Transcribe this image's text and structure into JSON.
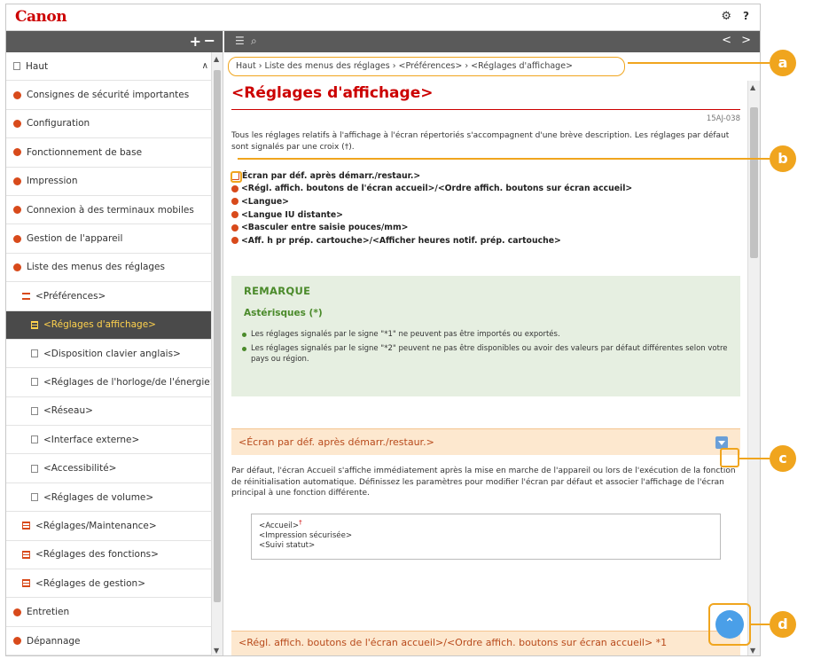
{
  "app": {
    "logo": "Canon",
    "settings_icon": "gear-icon",
    "help_label": "?"
  },
  "sidebar": {
    "plus": "+",
    "minus": "−",
    "items": [
      {
        "label": "Haut",
        "icon": "square"
      },
      {
        "label": "Consignes de sécurité importantes",
        "icon": "dot"
      },
      {
        "label": "Configuration",
        "icon": "dot"
      },
      {
        "label": "Fonctionnement de base",
        "icon": "dot"
      },
      {
        "label": "Impression",
        "icon": "dot"
      },
      {
        "label": "Connexion à des terminaux mobiles",
        "icon": "dot"
      },
      {
        "label": "Gestion de l'appareil",
        "icon": "dot"
      },
      {
        "label": "Liste des menus des réglages",
        "icon": "dot"
      },
      {
        "label": "<Préférences>",
        "icon": "minus"
      },
      {
        "label": "<Réglages d'affichage>",
        "icon": "square",
        "selected": true
      },
      {
        "label": "<Disposition clavier anglais>",
        "icon": "square"
      },
      {
        "label": "<Réglages de l'horloge/de l'énergie>",
        "icon": "square"
      },
      {
        "label": "<Réseau>",
        "icon": "square"
      },
      {
        "label": "<Interface externe>",
        "icon": "square"
      },
      {
        "label": "<Accessibilité>",
        "icon": "square"
      },
      {
        "label": "<Réglages de volume>",
        "icon": "square"
      },
      {
        "label": "<Réglages/Maintenance>",
        "icon": "square-orange"
      },
      {
        "label": "<Réglages des fonctions>",
        "icon": "square-orange"
      },
      {
        "label": "<Réglages de gestion>",
        "icon": "square-orange"
      },
      {
        "label": "Entretien",
        "icon": "dot"
      },
      {
        "label": "Dépannage",
        "icon": "dot"
      }
    ]
  },
  "toolbar": {
    "list_icon": "☰",
    "search_icon": "⌕",
    "prev": "<",
    "next": ">"
  },
  "breadcrumb": "Haut › Liste des menus des réglages › <Préférences> › <Réglages d'affichage>",
  "page": {
    "title": "<Réglages d'affichage>",
    "doc_id": "15AJ-038",
    "intro": "Tous les réglages relatifs à l'affichage à l'écran répertoriés s'accompagnent d'une brève description. Les réglages par défaut sont signalés par une croix (†).",
    "links": [
      "Écran par déf. après démarr./restaur.>",
      "<Régl. affich. boutons de l'écran accueil>/<Ordre affich. boutons sur écran accueil>",
      "<Langue>",
      "<Langue IU distante>",
      "<Basculer entre saisie pouces/mm>",
      "<Aff. h pr prép. cartouche>/<Afficher heures notif. prép. cartouche>"
    ],
    "note": {
      "title": "REMARQUE",
      "subtitle": "Astérisques (*)",
      "bullets": [
        "Les réglages signalés par le signe \"*1\" ne peuvent pas être importés ou exportés.",
        "Les réglages signalés par le signe \"*2\" peuvent ne pas être disponibles ou avoir des valeurs par défaut différentes selon votre pays ou région."
      ]
    },
    "section1": {
      "title": "<Écran par déf. après démarr./restaur.>",
      "body": "Par défaut, l'écran Accueil s'affiche immédiatement après la mise en marche de l'appareil ou lors de l'exécution de la fonction de réinitialisation automatique. Définissez les paramètres pour modifier l'écran par défaut et associer l'affichage de l'écran principal à une fonction différente.",
      "options": [
        "<Accueil>",
        "<Impression sécurisée>",
        "<Suivi statut>"
      ],
      "default_mark": "†"
    },
    "section2": {
      "title": "<Régl. affich. boutons de l'écran accueil>/<Ordre affich. boutons sur écran accueil> *1"
    }
  },
  "back_to_top": "⌃",
  "callouts": [
    "a",
    "b",
    "c",
    "d"
  ],
  "accent_colors": {
    "canon_red": "#cc0000",
    "callout": "#f0a51e",
    "note_green": "#4a8a2a",
    "section_bg": "#fde8cf"
  }
}
